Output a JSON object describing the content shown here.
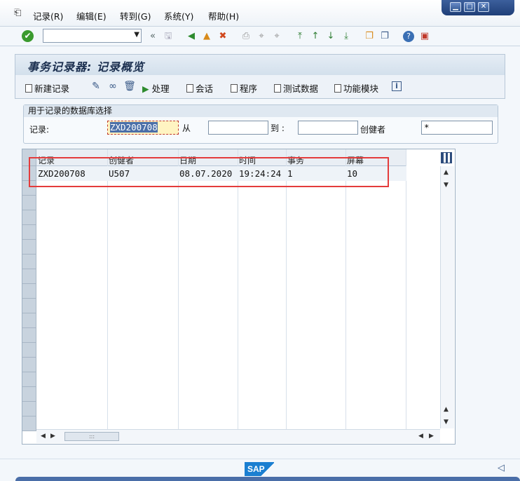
{
  "menubar": {
    "items": [
      "记录(R)",
      "编辑(E)",
      "转到(G)",
      "系统(Y)",
      "帮助(H)"
    ]
  },
  "toolbar": {
    "command_value": ""
  },
  "screen": {
    "title": "事务记录器: 记录概览"
  },
  "app_toolbar": {
    "new_recording": "新建记录",
    "process": "处理",
    "session": "会话",
    "program": "程序",
    "test_data": "测试数据",
    "function_module": "功能模块"
  },
  "selection": {
    "group_title": "用于记录的数据库选择",
    "recording_label": "记录:",
    "recording_value": "ZXD200708",
    "from_label": "从",
    "from_value": "",
    "to_label": "到 :",
    "to_value": "",
    "creator_label": "创健者",
    "creator_value": "*"
  },
  "grid": {
    "columns": [
      "记录",
      "创健者",
      "日期",
      "时间",
      "事务",
      "屏幕"
    ],
    "rows": [
      [
        "ZXD200708",
        "U507",
        "08.07.2020",
        "19:24:24",
        "1",
        "10"
      ]
    ]
  },
  "footer": {
    "logo": "SAP"
  }
}
